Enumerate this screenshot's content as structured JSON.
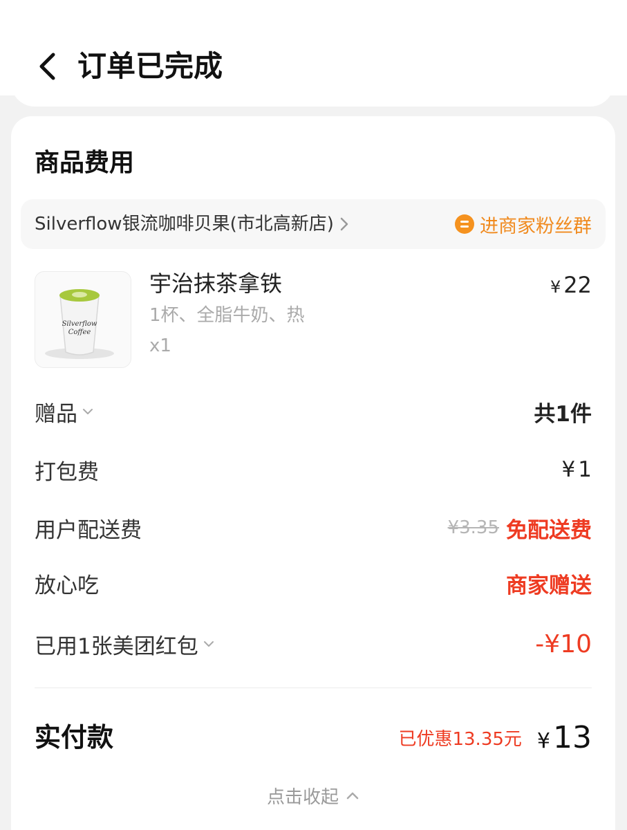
{
  "header": {
    "title": "订单已完成",
    "back_icon": "chevron-left-icon"
  },
  "section": {
    "title": "商品费用"
  },
  "shop": {
    "name": "Silverflow银流咖啡贝果(市北高新店)",
    "fan_group_label": "进商家粉丝群",
    "fan_group_color": "#f08a1e"
  },
  "product": {
    "name": "宇治抹茶拿铁",
    "spec": "1杯、全脂牛奶、热",
    "qty": "x1",
    "currency": "¥",
    "price": "22"
  },
  "fees": {
    "gift_label": "赠品",
    "gift_value": "共1件",
    "packing_label": "打包费",
    "packing_currency": "¥",
    "packing_value": "1",
    "delivery_label": "用户配送费",
    "delivery_original": "¥3.35",
    "delivery_value": "免配送费",
    "assurance_label": "放心吃",
    "assurance_value": "商家赠送",
    "coupon_label": "已用1张美团红包",
    "coupon_value": "-¥10"
  },
  "total": {
    "label": "实付款",
    "discount": "已优惠13.35元",
    "currency": "¥",
    "amount": "13"
  },
  "collapse_label": "点击收起",
  "colors": {
    "accent_red": "#ee3b22",
    "accent_orange": "#f08a1e"
  }
}
